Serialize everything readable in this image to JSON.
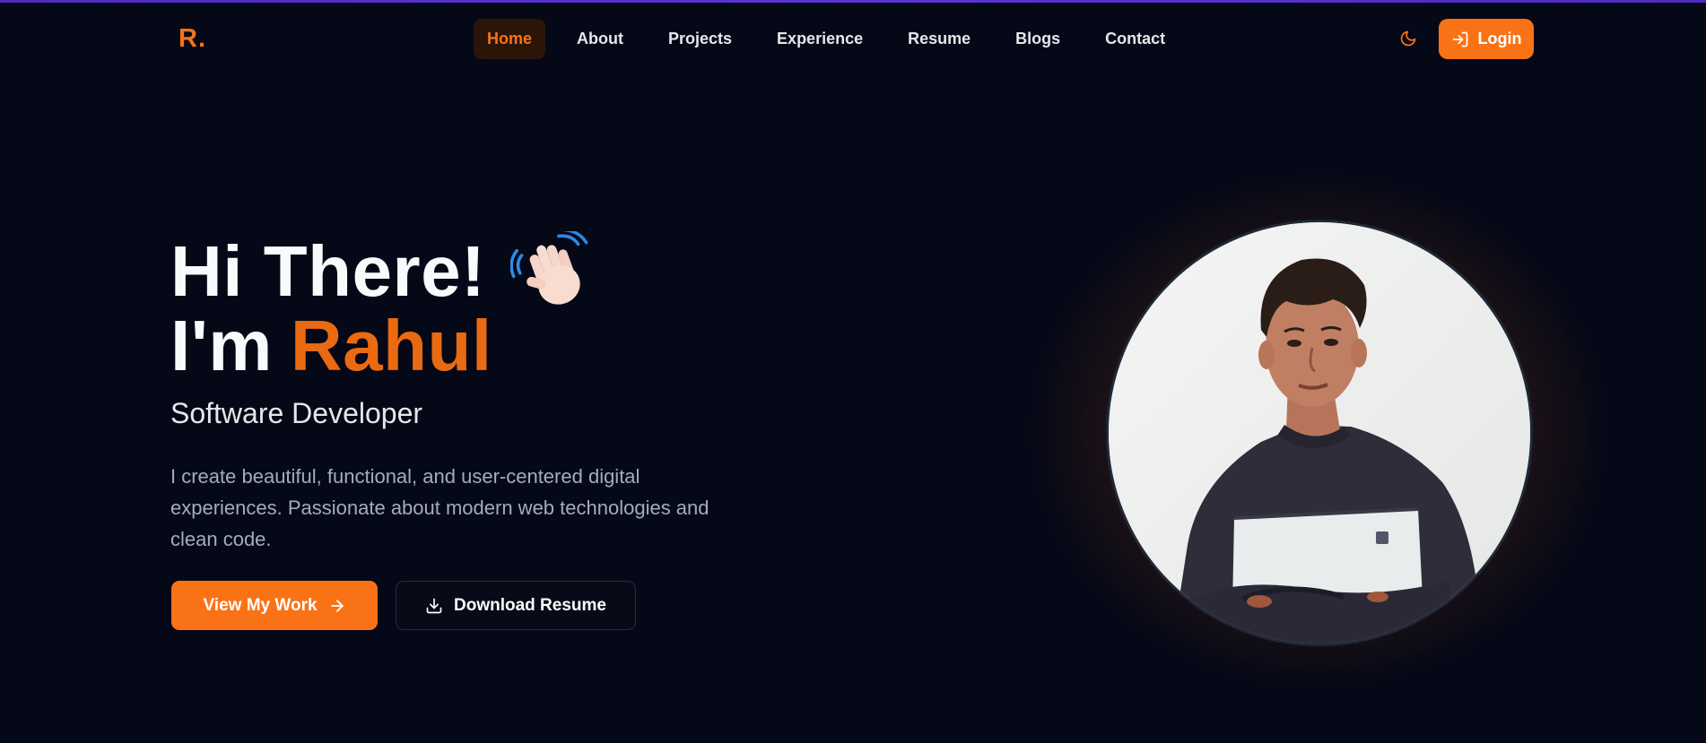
{
  "brand": {
    "logo": "R."
  },
  "nav": {
    "items": [
      {
        "label": "Home",
        "active": true
      },
      {
        "label": "About"
      },
      {
        "label": "Projects"
      },
      {
        "label": "Experience"
      },
      {
        "label": "Resume"
      },
      {
        "label": "Blogs"
      },
      {
        "label": "Contact"
      }
    ],
    "theme_icon": "moon-icon",
    "login_label": "Login",
    "login_icon": "login-icon"
  },
  "hero": {
    "greeting": "Hi There!",
    "greeting_icon": "waving-hand-icon",
    "intro": "I'm",
    "name": "Rahul",
    "role": "Software Developer",
    "description": "I create beautiful, functional, and user-centered digital experiences. Passionate about modern web technologies and clean code.",
    "primary_button": "View My Work",
    "primary_icon": "arrow-right-icon",
    "secondary_button": "Download Resume",
    "secondary_icon": "download-icon"
  },
  "colors": {
    "background": "#050816",
    "accent": "#f97316",
    "accent_dark": "#ea6a12",
    "muted_text": "#a3acbd"
  }
}
